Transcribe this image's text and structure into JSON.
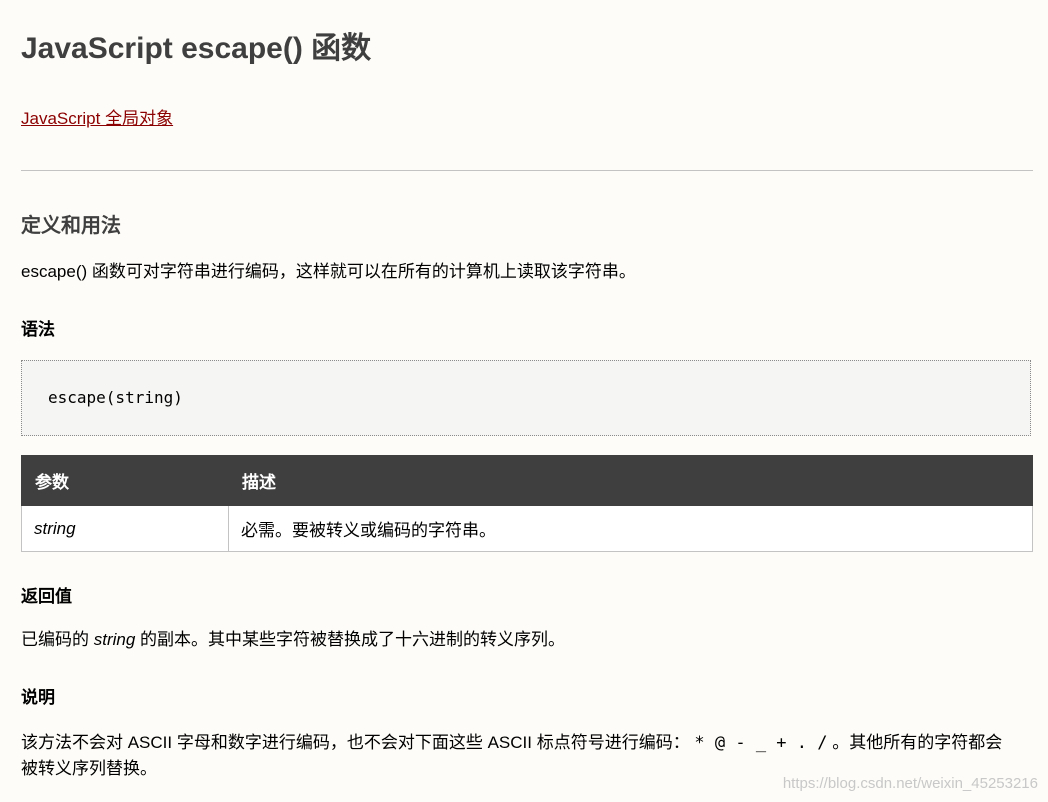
{
  "title": "JavaScript escape() 函数",
  "breadcrumb": "JavaScript 全局对象",
  "definition": {
    "heading": "定义和用法",
    "text": "escape() 函数可对字符串进行编码，这样就可以在所有的计算机上读取该字符串。"
  },
  "syntax": {
    "heading": "语法",
    "code": "escape(string)"
  },
  "params_table": {
    "headers": [
      "参数",
      "描述"
    ],
    "rows": [
      {
        "name": "string",
        "desc": "必需。要被转义或编码的字符串。"
      }
    ]
  },
  "return_value": {
    "heading": "返回值",
    "prefix": "已编码的 ",
    "italic": "string",
    "suffix": " 的副本。其中某些字符被替换成了十六进制的转义序列。"
  },
  "notes": {
    "heading": "说明",
    "text_a": "该方法不会对 ASCII 字母和数字进行编码，也不会对下面这些 ASCII 标点符号进行编码： ",
    "symbols": "* @ - _ + . /",
    "text_b": " 。其他所有的字符都会",
    "line2": "被转义序列替换。"
  },
  "watermark": "https://blog.csdn.net/weixin_45253216"
}
